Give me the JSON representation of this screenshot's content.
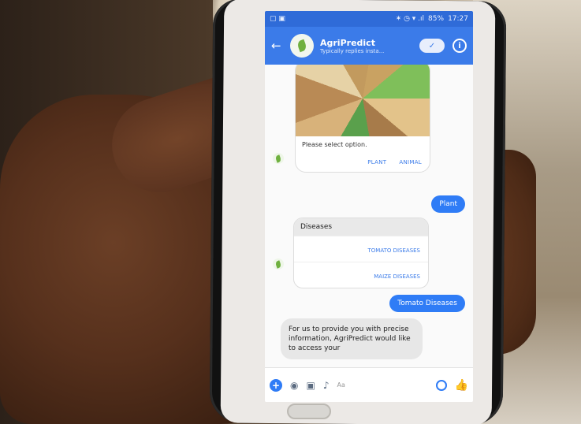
{
  "statusbar": {
    "left": "▢ ▣",
    "right_icons": "✶ ◷ ▾ .ıl",
    "battery": "85%",
    "time": "17:27"
  },
  "header": {
    "back": "←",
    "title": "AgriPredict",
    "subtitle": "Typically replies insta...",
    "toggle": "✓",
    "info": "i"
  },
  "messages": {
    "card1": {
      "prompt": "Please select option.",
      "options": [
        "PLANT",
        "ANIMAL"
      ]
    },
    "reply1": "Plant",
    "card2": {
      "title": "Diseases",
      "options": [
        "TOMATO DISEASES",
        "MAIZE DISEASES"
      ]
    },
    "reply2": "Tomato Diseases",
    "bot_text": "For us to provide you with precise information, AgriPredict would like to access your"
  },
  "composer": {
    "plus": "+",
    "camera": "◉",
    "gallery": "▣",
    "mic": "♪",
    "placeholder": "Aa",
    "like": "👍"
  },
  "colors": {
    "accent": "#3b7be9",
    "outgoing": "#2f7cf6",
    "bot_leaf": "#6fb03f"
  }
}
